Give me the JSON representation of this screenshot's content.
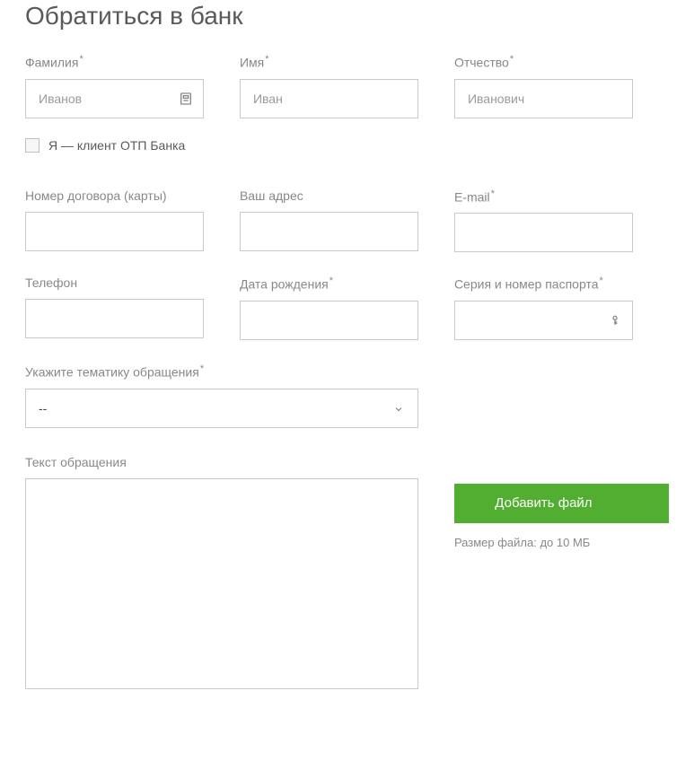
{
  "title": "Обратиться в банк",
  "fields": {
    "lastname": {
      "label": "Фамилия",
      "placeholder": "Иванов"
    },
    "firstname": {
      "label": "Имя",
      "placeholder": "Иван"
    },
    "patronymic": {
      "label": "Отчество",
      "placeholder": "Иванович"
    },
    "contractNumber": {
      "label": "Номер договора (карты)"
    },
    "address": {
      "label": "Ваш адрес"
    },
    "email": {
      "label": "E-mail"
    },
    "phone": {
      "label": "Телефон"
    },
    "birthdate": {
      "label": "Дата рождения"
    },
    "passport": {
      "label": "Серия и номер паспорта"
    },
    "topic": {
      "label": "Укажите тематику обращения",
      "selected": "--"
    },
    "message": {
      "label": "Текст обращения"
    }
  },
  "checkbox": {
    "label": "Я — клиент ОТП Банка"
  },
  "actions": {
    "addFile": "Добавить файл",
    "fileHint": "Размер файла: до 10 МБ"
  }
}
